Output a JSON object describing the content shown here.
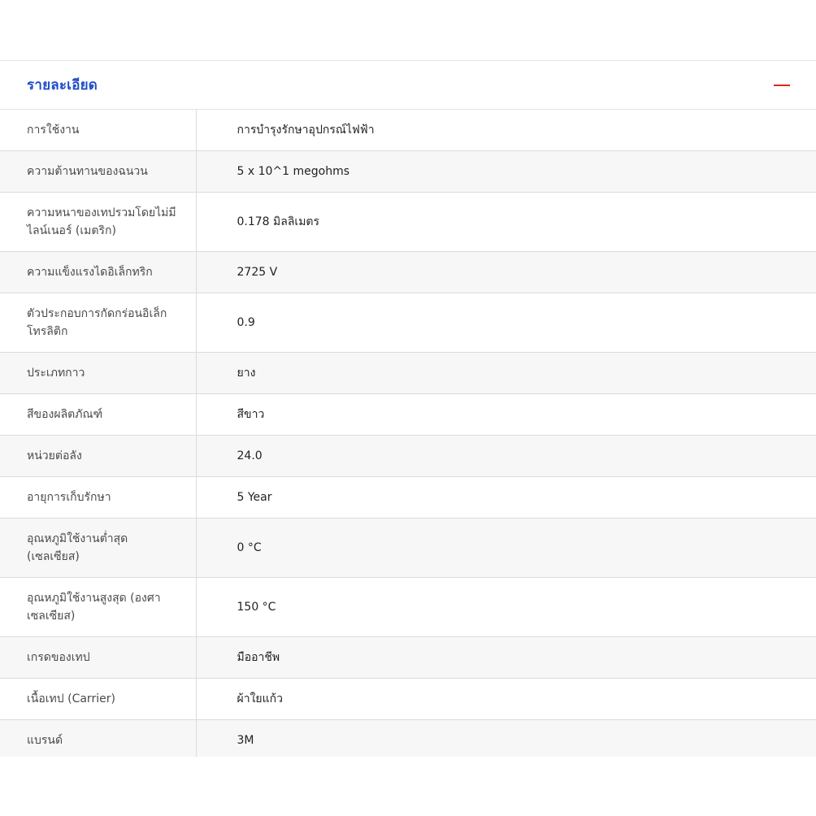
{
  "section": {
    "title": "รายละเอียด",
    "collapse_icon": "minus-icon",
    "accent_color": "#1f4fc8",
    "icon_color": "#e0241b"
  },
  "specs": [
    {
      "label": "การใช้งาน",
      "value": "การบำรุงรักษาอุปกรณ์ไฟฟ้า"
    },
    {
      "label": "ความต้านทานของฉนวน",
      "value": "5 x 10^1 megohms"
    },
    {
      "label": "ความหนาของเทปรวมโดยไม่มีไลน์เนอร์ (เมตริก)",
      "value": "0.178 มิลลิเมตร"
    },
    {
      "label": "ความแข็งแรงไดอิเล็กทริก",
      "value": "2725 V"
    },
    {
      "label": "ตัวประกอบการกัดกร่อนอิเล็กโทรลิติก",
      "value": "0.9"
    },
    {
      "label": "ประเภทกาว",
      "value": "ยาง"
    },
    {
      "label": "สีของผลิตภัณฑ์",
      "value": "สีขาว"
    },
    {
      "label": "หน่วยต่อลัง",
      "value": "24.0"
    },
    {
      "label": "อายุการเก็บรักษา",
      "value": "5 Year"
    },
    {
      "label": "อุณหภูมิใช้งานต่ำสุด (เซลเซียส)",
      "value": "0 °C"
    },
    {
      "label": "อุณหภูมิใช้งานสูงสุด (องศาเซลเซียส)",
      "value": "150 °C"
    },
    {
      "label": "เกรดของเทป",
      "value": "มืออาชีพ"
    },
    {
      "label": "เนื้อเทป (Carrier)",
      "value": "ผ้าใยแก้ว"
    },
    {
      "label": "แบรนด์",
      "value": "3M"
    }
  ]
}
